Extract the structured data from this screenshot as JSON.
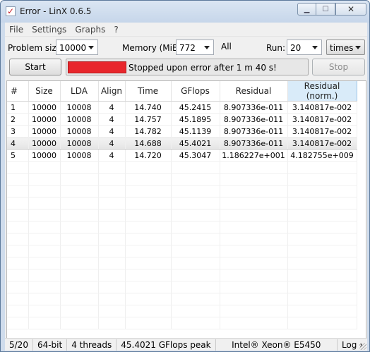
{
  "window": {
    "title": "Error - LinX 0.6.5"
  },
  "menu": [
    "File",
    "Settings",
    "Graphs",
    "?"
  ],
  "controls": {
    "problem_size_label": "Problem size:",
    "problem_size_value": "10000",
    "memory_label": "Memory (MiB):",
    "memory_value": "772",
    "all_label": "All",
    "run_label": "Run:",
    "run_value": "20",
    "run_unit": "times"
  },
  "actions": {
    "start_label": "Start",
    "stop_label": "Stop",
    "status_text": "Stopped upon error after 1 m 40 s!",
    "status_color": "#e8262c"
  },
  "table": {
    "columns": [
      "#",
      "Size",
      "LDA",
      "Align",
      "Time",
      "GFlops",
      "Residual",
      "Residual (norm.)"
    ],
    "rows": [
      [
        "1",
        "10000",
        "10008",
        "4",
        "14.740",
        "45.2415",
        "8.907336e-011",
        "3.140817e-002"
      ],
      [
        "2",
        "10000",
        "10008",
        "4",
        "14.757",
        "45.1895",
        "8.907336e-011",
        "3.140817e-002"
      ],
      [
        "3",
        "10000",
        "10008",
        "4",
        "14.782",
        "45.1139",
        "8.907336e-011",
        "3.140817e-002"
      ],
      [
        "4",
        "10000",
        "10008",
        "4",
        "14.688",
        "45.4021",
        "8.907336e-011",
        "3.140817e-002"
      ],
      [
        "5",
        "10000",
        "10008",
        "4",
        "14.720",
        "45.3047",
        "1.186227e+001",
        "4.182755e+009"
      ]
    ]
  },
  "statusbar": {
    "progress": "5/20",
    "bits": "64-bit",
    "threads": "4 threads",
    "peak": "45.4021 GFlops peak",
    "cpu": "Intel® Xeon® E5450",
    "log": "Log ›"
  }
}
